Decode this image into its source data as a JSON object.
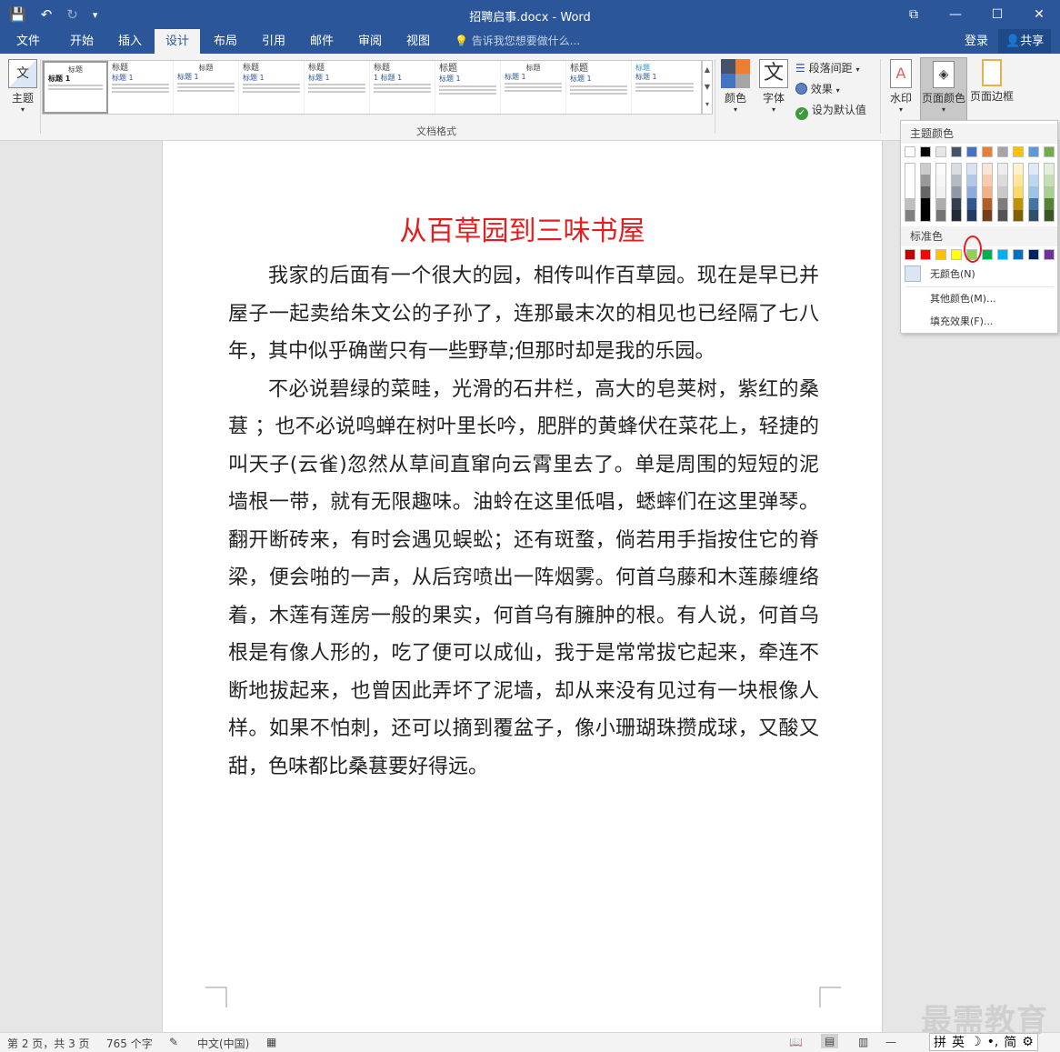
{
  "window": {
    "title": "招聘启事.docx - Word",
    "controls": {
      "restore_ribbon": "⧉",
      "minimize": "—",
      "maximize": "☐",
      "close": "✕"
    }
  },
  "qat": {
    "save_icon": "💾",
    "undo_icon": "↶",
    "redo_icon": "↻",
    "customize_icon": "▾"
  },
  "tabs": [
    "文件",
    "开始",
    "插入",
    "设计",
    "布局",
    "引用",
    "邮件",
    "审阅",
    "视图"
  ],
  "active_tab": "设计",
  "tell_me": "告诉我您想要做什么...",
  "account": {
    "login": "登录",
    "share": "共享"
  },
  "ribbon": {
    "theme_label": "主题",
    "gallery_group": "文档格式",
    "gallery_items": [
      {
        "title": "标题",
        "heading": "标题 1"
      },
      {
        "title": "标题",
        "heading": "标题 1"
      },
      {
        "title": "标题",
        "heading": "标题 1"
      },
      {
        "title": "标题",
        "heading": "标题 1"
      },
      {
        "title": "标题",
        "heading": "标题 1"
      },
      {
        "title": "标题",
        "heading": "1 标题 1"
      },
      {
        "title": "标题",
        "heading": "标题 1"
      },
      {
        "title": "标题",
        "heading": "标题 1"
      },
      {
        "title": "标题",
        "heading": "标题 1"
      },
      {
        "title": "标题",
        "heading": "标题 1"
      }
    ],
    "colors_label": "颜色",
    "fonts_label": "字体",
    "fonts_glyph": "文",
    "paragraph_spacing": "段落间距",
    "effects": "效果",
    "set_default": "设为默认值",
    "watermark": "水印",
    "page_color": "页面颜色",
    "page_borders": "页面边框"
  },
  "page_color_menu": {
    "theme_colors_header": "主题颜色",
    "standard_colors_header": "标准色",
    "theme_colors": [
      "#ffffff",
      "#000000",
      "#e7e6e6",
      "#44546a",
      "#4472c4",
      "#ed7d31",
      "#a5a5a5",
      "#ffc000",
      "#5b9bd5",
      "#70ad47"
    ],
    "standard_colors": [
      "#c00000",
      "#ff0000",
      "#ffc000",
      "#ffff00",
      "#92d050",
      "#00b050",
      "#00b0f0",
      "#0070c0",
      "#002060",
      "#7030a0"
    ],
    "highlighted_color": "#92d050",
    "no_color": "无颜色(N)",
    "more_colors": "其他颜色(M)...",
    "fill_effects": "填充效果(F)..."
  },
  "document": {
    "title": "从百草园到三味书屋",
    "paragraphs": [
      "我家的后面有一个很大的园，相传叫作百草园。现在是早已并屋子一起卖给朱文公的子孙了，连那最末次的相见也已经隔了七八年，其中似乎确凿只有一些野草;但那时却是我的乐园。",
      "不必说碧绿的菜畦，光滑的石井栏，高大的皂荚树，紫红的桑葚 ；也不必说鸣蝉在树叶里长吟，肥胖的黄蜂伏在菜花上，轻捷的叫天子(云雀)忽然从草间直窜向云霄里去了。单是周围的短短的泥墙根一带，就有无限趣味。油蛉在这里低唱，蟋蟀们在这里弹琴。翻开断砖来，有时会遇见蜈蚣；还有斑蝥，倘若用手指按住它的脊梁，便会啪的一声，从后窍喷出一阵烟雾。何首乌藤和木莲藤缠络着，木莲有莲房一般的果实，何首乌有臃肿的根。有人说，何首乌根是有像人形的，吃了便可以成仙，我于是常常拔它起来，牵连不断地拔起来，也曾因此弄坏了泥墙，却从来没有见过有一块根像人样。如果不怕刺，还可以摘到覆盆子，像小珊瑚珠攒成球，又酸又甜，色味都比桑葚要好得远。"
    ]
  },
  "status": {
    "page": "第 2 页，共 3 页",
    "words": "765 个字",
    "language": "中文(中国)"
  },
  "watermark_text": "最需教育",
  "ime": [
    "拼",
    "英",
    "☽",
    "•,",
    "简",
    "⚙"
  ]
}
